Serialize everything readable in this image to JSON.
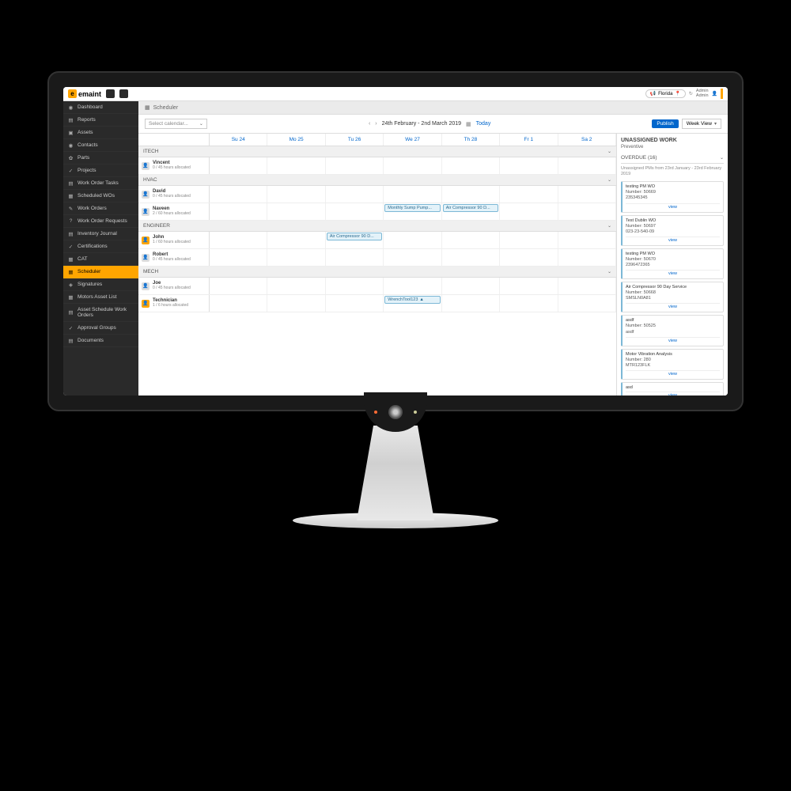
{
  "brand": "emaint",
  "location": "Florida",
  "user": {
    "line1": "Admin",
    "line2": "Admin"
  },
  "sidebar": [
    {
      "label": "Dashboard",
      "icon": "◉"
    },
    {
      "label": "Reports",
      "icon": "▤"
    },
    {
      "label": "Assets",
      "icon": "▣"
    },
    {
      "label": "Contacts",
      "icon": "◉"
    },
    {
      "label": "Parts",
      "icon": "✿"
    },
    {
      "label": "Projects",
      "icon": "✓"
    },
    {
      "label": "Work Order Tasks",
      "icon": "▤"
    },
    {
      "label": "Scheduled WOs",
      "icon": "▦"
    },
    {
      "label": "Work Orders",
      "icon": "✎"
    },
    {
      "label": "Work Order Requests",
      "icon": "?"
    },
    {
      "label": "Inventory Journal",
      "icon": "▤"
    },
    {
      "label": "Certifications",
      "icon": "✓"
    },
    {
      "label": "CAT",
      "icon": "▦"
    },
    {
      "label": "Scheduler",
      "icon": "▦",
      "active": true
    },
    {
      "label": "Signatures",
      "icon": "◈"
    },
    {
      "label": "Motors Asset List",
      "icon": "▦"
    },
    {
      "label": "Asset Schedule Work Orders",
      "icon": "▤"
    },
    {
      "label": "Approval Groups",
      "icon": "✓"
    },
    {
      "label": "Documents",
      "icon": "▤"
    }
  ],
  "breadcrumb": "Scheduler",
  "toolbar": {
    "calendarPlaceholder": "Select calendar...",
    "range": "24th February - 2nd March 2019",
    "today": "Today",
    "publish": "Publish",
    "view": "Week View"
  },
  "days": [
    "Su 24",
    "Mo 25",
    "Tu 26",
    "We 27",
    "Th 28",
    "Fr 1",
    "Sa 2"
  ],
  "groups": [
    {
      "name": "ITECH",
      "people": [
        {
          "name": "Vincent",
          "hours": "0 / 45 hours allocated",
          "events": []
        }
      ]
    },
    {
      "name": "HVAC",
      "people": [
        {
          "name": "David",
          "hours": "0 / 45 hours allocated",
          "events": []
        },
        {
          "name": "Naveen",
          "hours": "2 / 60 hours allocated",
          "events": [
            {
              "day": 3,
              "label": "Monthly Sump Pump..."
            },
            {
              "day": 4,
              "label": "Air Compressor 90 D..."
            }
          ]
        }
      ]
    },
    {
      "name": "ENGINEER",
      "people": [
        {
          "name": "John",
          "hours": "1 / 60 hours allocated",
          "avatar": "y",
          "events": [
            {
              "day": 2,
              "label": "Air Compressor 90 D..."
            }
          ]
        },
        {
          "name": "Robert",
          "hours": "0 / 45 hours allocated",
          "events": []
        }
      ]
    },
    {
      "name": "MECH",
      "people": [
        {
          "name": "Joe",
          "hours": "0 / 45 hours allocated",
          "events": []
        },
        {
          "name": "Technician",
          "hours": "1 / 6 hours allocated",
          "avatar": "y",
          "events": [
            {
              "day": 3,
              "label": "WrenchTool123",
              "alert": true
            }
          ]
        }
      ]
    }
  ],
  "rpanel": {
    "title": "UNASSIGNED WORK",
    "subtitle": "Preventive",
    "overdueLabel": "OVERDUE (16)",
    "overdueDesc": "Unassigned PMs from 23rd January - 23rd February 2019",
    "viewLabel": "view",
    "cards": [
      {
        "title": "testing PM WO",
        "l1": "Number: 50669",
        "l2": "235345345"
      },
      {
        "title": "Test Dublin WO",
        "l1": "Number: 50697",
        "l2": "023-23-540-09"
      },
      {
        "title": "testing PM WO",
        "l1": "Number: 50670",
        "l2": "2396472365"
      },
      {
        "title": "Air Compressor 90 Day Service",
        "l1": "Number: 50668",
        "l2": "SMSLN0A81"
      },
      {
        "title": "asdf",
        "l1": "Number: 50525",
        "l2": "asdf"
      },
      {
        "title": "Motor Vibration Analysis",
        "l1": "Number: 280",
        "l2": "MTR123FLK"
      },
      {
        "title": "asd",
        "l1": "",
        "l2": ""
      }
    ]
  }
}
